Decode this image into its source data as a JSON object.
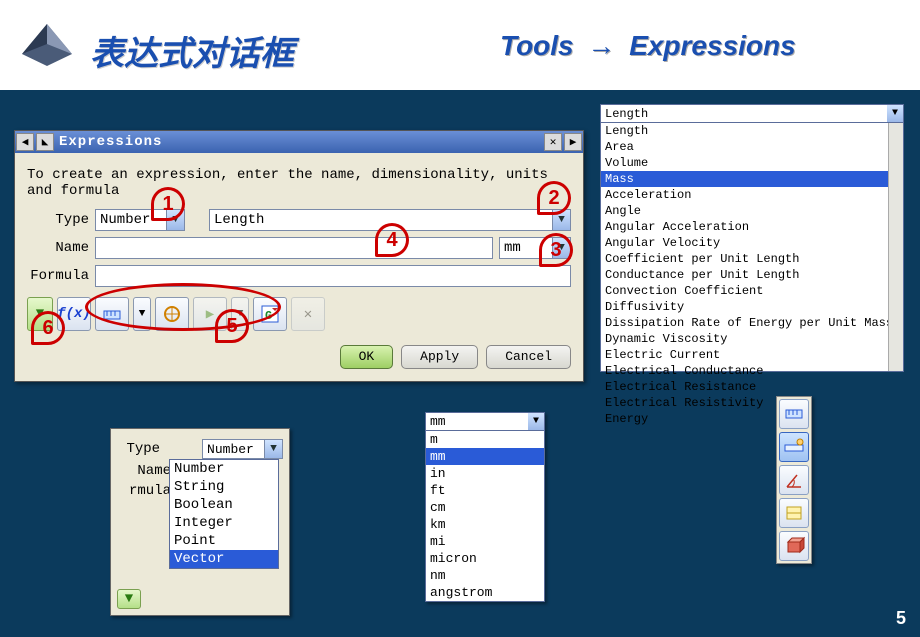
{
  "header": {
    "title_cn": "表达式对话框",
    "crumb_left": "Tools",
    "crumb_right": "Expressions"
  },
  "dialog": {
    "title": "Expressions",
    "hint": "To create an expression, enter the name, dimensionality, units and formula",
    "type_label": "Type",
    "type_value": "Number",
    "dim_value": "Length",
    "name_label": "Name",
    "name_value": "",
    "unit_value": "mm",
    "formula_label": "Formula",
    "formula_value": "",
    "ok": "OK",
    "apply": "Apply",
    "cancel": "Cancel"
  },
  "badges": {
    "b1": "1",
    "b2": "2",
    "b3": "3",
    "b4": "4",
    "b5": "5",
    "b6": "6"
  },
  "dim_list": {
    "selected": "Length",
    "options": [
      "Length",
      "Area",
      "Volume",
      "Mass",
      "Acceleration",
      "Angle",
      "Angular Acceleration",
      "Angular Velocity",
      "Coefficient per Unit Length",
      "Conductance per Unit Length",
      "Convection Coefficient",
      "Diffusivity",
      "Dissipation Rate of Energy per Unit Mass",
      "Dynamic Viscosity",
      "Electric Current",
      "Electrical Conductance",
      "Electrical Resistance",
      "Electrical Resistivity",
      "Energy"
    ],
    "highlight": "Mass"
  },
  "type_popup": {
    "type_label": "Type",
    "name_label": "Name",
    "formula_label": "rmula",
    "selected": "Number",
    "options": [
      "Number",
      "String",
      "Boolean",
      "Integer",
      "Point",
      "Vector"
    ],
    "highlight": "Vector"
  },
  "unit_popup": {
    "selected": "mm",
    "options": [
      "m",
      "mm",
      "in",
      "ft",
      "cm",
      "km",
      "mi",
      "micron",
      "nm",
      "angstrom"
    ],
    "highlight": "mm"
  },
  "page_number": "5"
}
